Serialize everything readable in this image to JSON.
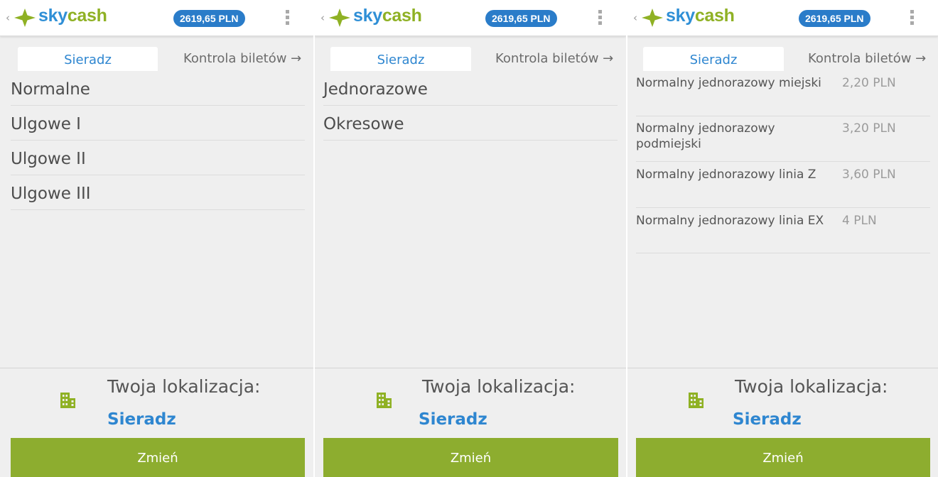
{
  "brand": {
    "name_part1": "sky",
    "name_part2": "cash",
    "colors": {
      "sky": "#2f8fd6",
      "cash": "#8fb124",
      "accent_blue": "#2a7cc9",
      "button_green": "#8dad2f"
    }
  },
  "header": {
    "back_icon": "chevron-left-icon",
    "back_glyph": "‹",
    "balance": "2619,65 PLN",
    "menu_icon": "kebab-menu-icon"
  },
  "tabs": {
    "active_label": "Sieradz",
    "secondary_label": "Kontrola biletów →"
  },
  "screens": [
    {
      "list": [
        "Normalne",
        "Ulgowe I",
        "Ulgowe II",
        "Ulgowe III"
      ]
    },
    {
      "list": [
        "Jednorazowe",
        "Okresowe"
      ]
    },
    {
      "tickets": [
        {
          "name": "Normalny jednorazowy miejski",
          "price": "2,20 PLN"
        },
        {
          "name": "Normalny jednorazowy podmiejski",
          "price": "3,20 PLN"
        },
        {
          "name": "Normalny jednorazowy linia Z",
          "price": "3,60 PLN"
        },
        {
          "name": "Normalny jednorazowy linia EX",
          "price": "4 PLN"
        }
      ]
    }
  ],
  "location": {
    "icon": "building-icon",
    "label": "Twoja lokalizacja:",
    "city": "Sieradz",
    "change_label": "Zmień"
  }
}
